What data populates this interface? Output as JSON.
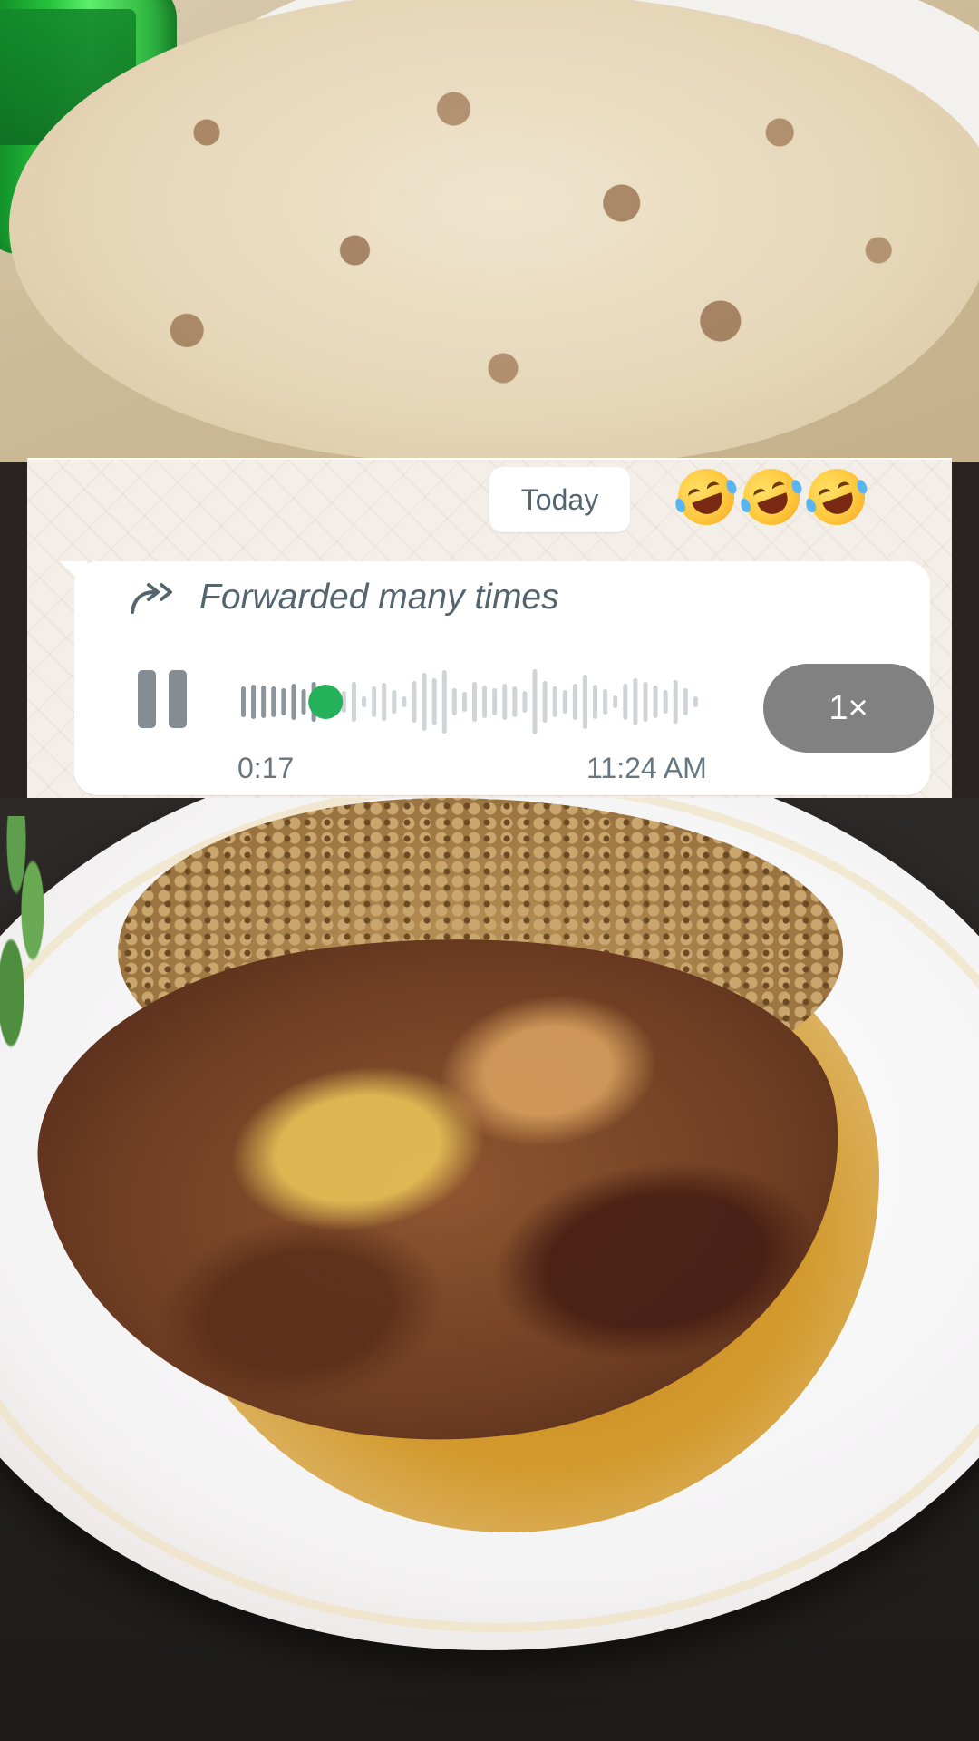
{
  "chat": {
    "date_chip": "Today",
    "reactions": [
      "🤣",
      "🤣",
      "🤣"
    ],
    "message": {
      "forwarded_label": "Forwarded many times",
      "voice_note": {
        "duration": "0:17",
        "timestamp": "11:24 AM",
        "playback_speed": "1×",
        "progress": 0.12,
        "state": "playing"
      }
    }
  },
  "colors": {
    "accent": "#25b05a",
    "played_bar": "#8c959c",
    "unplayed_bar": "#cfd4d7",
    "speed_pill": "#818181"
  },
  "icons": {
    "forward": "double-arrow-forward-icon",
    "pause": "pause-icon",
    "emoji": "rolling-on-floor-laughing-emoji"
  }
}
